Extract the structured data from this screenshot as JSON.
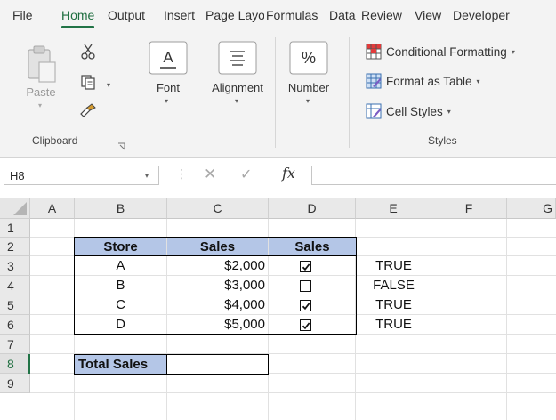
{
  "ribbon_tabs": [
    "File",
    "Home",
    "Output",
    "Insert",
    "Page Layout",
    "Formulas",
    "Data",
    "Review",
    "View",
    "Developer"
  ],
  "active_tab": "Home",
  "clipboard": {
    "paste_label": "Paste",
    "group_label": "Clipboard",
    "launcher_icon": "dialog-launcher-icon"
  },
  "font_group": {
    "label": "Font",
    "icon": "font-A-icon"
  },
  "alignment_group": {
    "label": "Alignment",
    "icon": "align-lines-icon"
  },
  "number_group": {
    "label": "Number",
    "icon": "percent-icon",
    "symbol": "%"
  },
  "styles_group": {
    "items": [
      "Conditional Formatting",
      "Format as Table",
      "Cell Styles"
    ],
    "group_label": "Styles"
  },
  "formula_bar": {
    "name_box": "H8",
    "fx_symbol": "fx",
    "formula": ""
  },
  "columns": [
    "A",
    "B",
    "C",
    "D",
    "E",
    "F",
    "G"
  ],
  "rows": [
    "1",
    "2",
    "3",
    "4",
    "5",
    "6",
    "7",
    "8",
    "9"
  ],
  "selected_row": "8",
  "table": {
    "headers": [
      "Store",
      "Sales",
      "Sales"
    ],
    "rows": [
      {
        "store": "A",
        "sales": "$2,000",
        "checked": true,
        "result": "TRUE"
      },
      {
        "store": "B",
        "sales": "$3,000",
        "checked": false,
        "result": "FALSE"
      },
      {
        "store": "C",
        "sales": "$4,000",
        "checked": true,
        "result": "TRUE"
      },
      {
        "store": "D",
        "sales": "$5,000",
        "checked": true,
        "result": "TRUE"
      }
    ]
  },
  "total": {
    "label": "Total Sales",
    "value": ""
  },
  "colors": {
    "accent": "#217346",
    "header_fill": "#b4c6e7"
  }
}
